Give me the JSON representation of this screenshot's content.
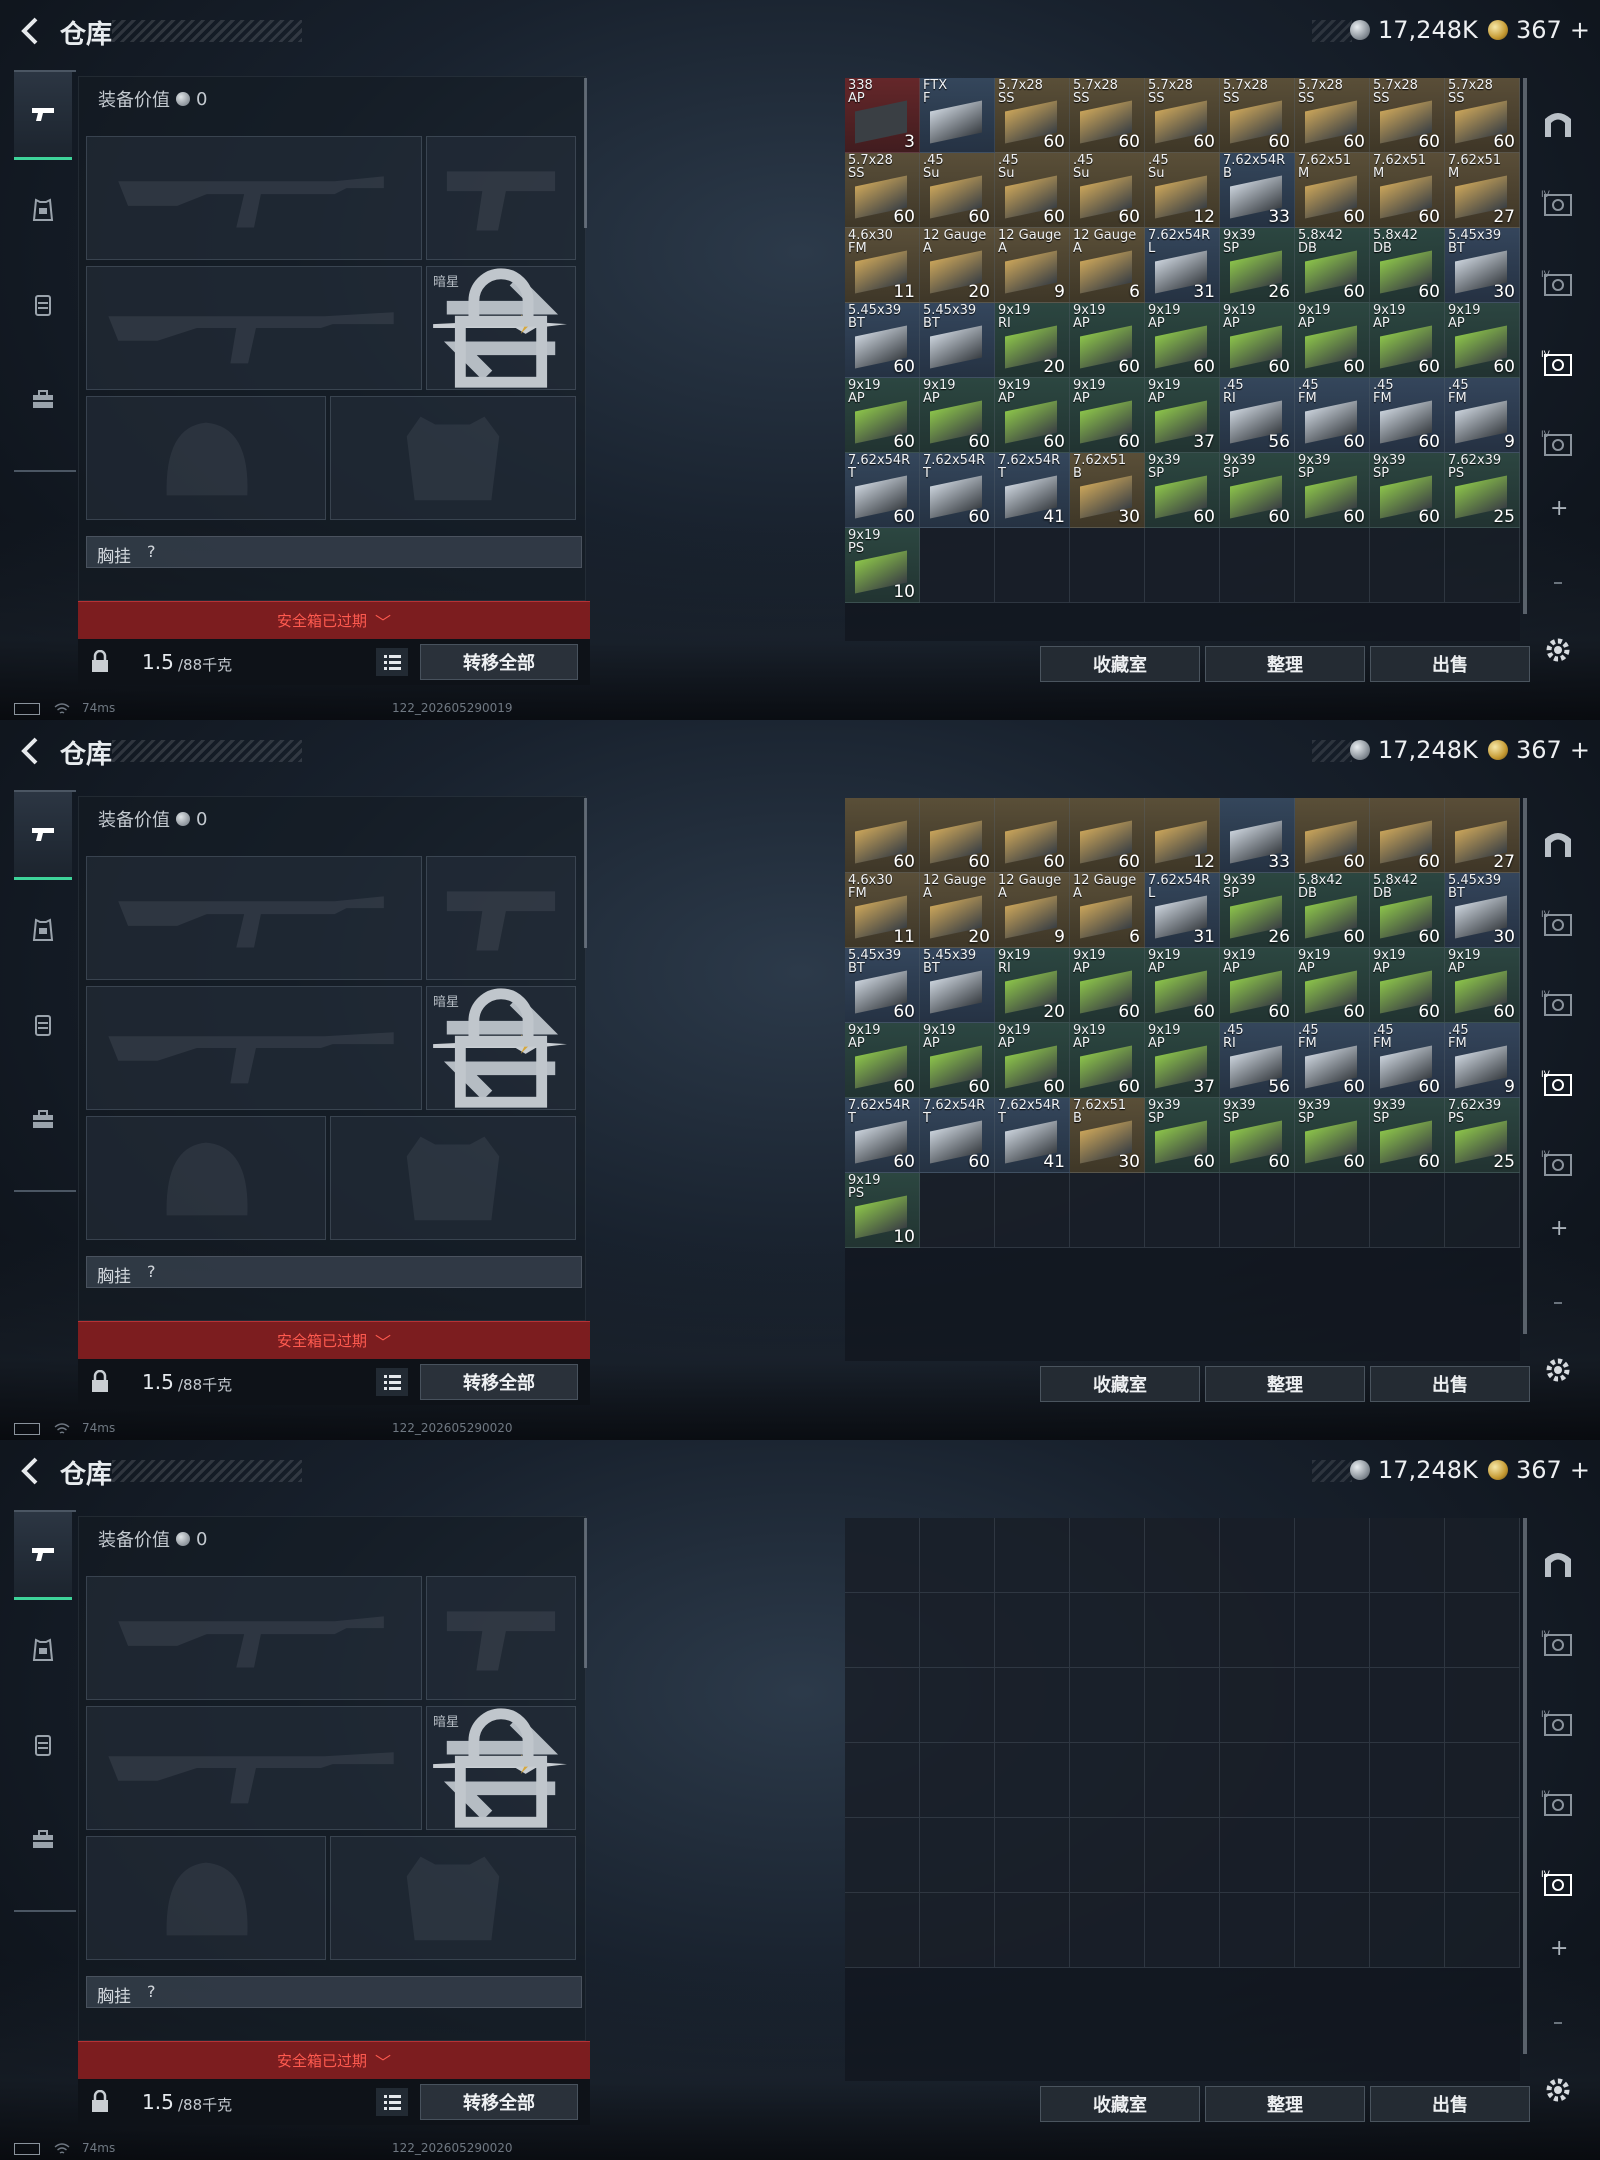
{
  "common": {
    "title": "仓库",
    "silver_amount": "17,248K",
    "gold_amount": "367",
    "gold_plus": "+",
    "equip_value_label": "装备价值",
    "equip_value": "0",
    "knife_label": "暗星",
    "chest_rig_label": "胸挂",
    "chest_rig_help": "?",
    "safe_box_status": "安全箱已过期",
    "safe_box_chevron": "﹀",
    "weight_value": "1.5",
    "weight_unit": "/88千克",
    "transfer_all": "转移全部",
    "collection_room": "收藏室",
    "sort": "整理",
    "sell": "出售",
    "ping": "74ms",
    "accent_color": "#3ed39a",
    "warning_color": "#ff5a4f"
  },
  "screens": [
    {
      "build_id": "122_202605290019",
      "active_stash_tab": 3,
      "rows": [
        [
          [
            "338\nAP",
            "3",
            "red"
          ],
          [
            "FTX\nF",
            "",
            "blue"
          ],
          [
            "5.7x28\nSS",
            "60",
            "gold"
          ],
          [
            "5.7x28\nSS",
            "60",
            "gold"
          ],
          [
            "5.7x28\nSS",
            "60",
            "gold"
          ],
          [
            "5.7x28\nSS",
            "60",
            "gold"
          ],
          [
            "5.7x28\nSS",
            "60",
            "gold"
          ],
          [
            "5.7x28\nSS",
            "60",
            "gold"
          ],
          [
            "5.7x28\nSS",
            "60",
            "gold"
          ]
        ],
        [
          [
            "5.7x28\nSS",
            "60",
            "gold"
          ],
          [
            ".45\nSu",
            "60",
            "gold"
          ],
          [
            ".45\nSu",
            "60",
            "gold"
          ],
          [
            ".45\nSu",
            "60",
            "gold"
          ],
          [
            ".45\nSu",
            "12",
            "gold"
          ],
          [
            "7.62x54R\nB",
            "33",
            "blue"
          ],
          [
            "7.62x51\nM",
            "60",
            "gold"
          ],
          [
            "7.62x51\nM",
            "60",
            "gold"
          ],
          [
            "7.62x51\nM",
            "27",
            "gold"
          ]
        ],
        [
          [
            "4.6x30\nFM",
            "11",
            "gold"
          ],
          [
            "12 Gauge\nA",
            "20",
            "gold"
          ],
          [
            "12 Gauge\nA",
            "9",
            "gold"
          ],
          [
            "12 Gauge\nA",
            "6",
            "gold"
          ],
          [
            "7.62x54R\nL",
            "31",
            "blue"
          ],
          [
            "9x39\nSP",
            "26",
            "green"
          ],
          [
            "5.8x42\nDB",
            "60",
            "green"
          ],
          [
            "5.8x42\nDB",
            "60",
            "green"
          ],
          [
            "5.45x39\nBT",
            "30",
            "blue"
          ]
        ],
        [
          [
            "5.45x39\nBT",
            "60",
            "blue"
          ],
          [
            "5.45x39\nBT",
            "",
            "blue"
          ],
          [
            "9x19\nRI",
            "20",
            "green"
          ],
          [
            "9x19\nAP",
            "60",
            "green"
          ],
          [
            "9x19\nAP",
            "60",
            "green"
          ],
          [
            "9x19\nAP",
            "60",
            "green"
          ],
          [
            "9x19\nAP",
            "60",
            "green"
          ],
          [
            "9x19\nAP",
            "60",
            "green"
          ],
          [
            "9x19\nAP",
            "60",
            "green"
          ]
        ],
        [
          [
            "9x19\nAP",
            "60",
            "green"
          ],
          [
            "9x19\nAP",
            "60",
            "green"
          ],
          [
            "9x19\nAP",
            "60",
            "green"
          ],
          [
            "9x19\nAP",
            "60",
            "green"
          ],
          [
            "9x19\nAP",
            "37",
            "green"
          ],
          [
            ".45\nRI",
            "56",
            "blue"
          ],
          [
            ".45\nFM",
            "60",
            "blue"
          ],
          [
            ".45\nFM",
            "60",
            "blue"
          ],
          [
            ".45\nFM",
            "9",
            "blue"
          ]
        ],
        [
          [
            "7.62x54R\nT",
            "60",
            "blue"
          ],
          [
            "7.62x54R\nT",
            "60",
            "blue"
          ],
          [
            "7.62x54R\nT",
            "41",
            "blue"
          ],
          [
            "7.62x51\nB",
            "30",
            "gold"
          ],
          [
            "9x39\nSP",
            "60",
            "green"
          ],
          [
            "9x39\nSP",
            "60",
            "green"
          ],
          [
            "9x39\nSP",
            "60",
            "green"
          ],
          [
            "9x39\nSP",
            "60",
            "green"
          ],
          [
            "7.62x39\nPS",
            "25",
            "green"
          ]
        ],
        [
          [
            "9x19\nPS",
            "10",
            "green"
          ],
          null,
          null,
          null,
          null,
          null,
          null,
          null,
          null
        ]
      ]
    },
    {
      "build_id": "122_202605290020",
      "active_stash_tab": 3,
      "rows": [
        [
          [
            "",
            "60",
            "gold"
          ],
          [
            "",
            "60",
            "gold"
          ],
          [
            "",
            "60",
            "gold"
          ],
          [
            "",
            "60",
            "gold"
          ],
          [
            "",
            "12",
            "gold"
          ],
          [
            "",
            "33",
            "blue"
          ],
          [
            "",
            "60",
            "gold"
          ],
          [
            "",
            "60",
            "gold"
          ],
          [
            "",
            "27",
            "gold"
          ]
        ],
        [
          [
            "4.6x30\nFM",
            "11",
            "gold"
          ],
          [
            "12 Gauge\nA",
            "20",
            "gold"
          ],
          [
            "12 Gauge\nA",
            "9",
            "gold"
          ],
          [
            "12 Gauge\nA",
            "6",
            "gold"
          ],
          [
            "7.62x54R\nL",
            "31",
            "blue"
          ],
          [
            "9x39\nSP",
            "26",
            "green"
          ],
          [
            "5.8x42\nDB",
            "60",
            "green"
          ],
          [
            "5.8x42\nDB",
            "60",
            "green"
          ],
          [
            "5.45x39\nBT",
            "30",
            "blue"
          ]
        ],
        [
          [
            "5.45x39\nBT",
            "60",
            "blue"
          ],
          [
            "5.45x39\nBT",
            "",
            "blue"
          ],
          [
            "9x19\nRI",
            "20",
            "green"
          ],
          [
            "9x19\nAP",
            "60",
            "green"
          ],
          [
            "9x19\nAP",
            "60",
            "green"
          ],
          [
            "9x19\nAP",
            "60",
            "green"
          ],
          [
            "9x19\nAP",
            "60",
            "green"
          ],
          [
            "9x19\nAP",
            "60",
            "green"
          ],
          [
            "9x19\nAP",
            "60",
            "green"
          ]
        ],
        [
          [
            "9x19\nAP",
            "60",
            "green"
          ],
          [
            "9x19\nAP",
            "60",
            "green"
          ],
          [
            "9x19\nAP",
            "60",
            "green"
          ],
          [
            "9x19\nAP",
            "60",
            "green"
          ],
          [
            "9x19\nAP",
            "37",
            "green"
          ],
          [
            ".45\nRI",
            "56",
            "blue"
          ],
          [
            ".45\nFM",
            "60",
            "blue"
          ],
          [
            ".45\nFM",
            "60",
            "blue"
          ],
          [
            ".45\nFM",
            "9",
            "blue"
          ]
        ],
        [
          [
            "7.62x54R\nT",
            "60",
            "blue"
          ],
          [
            "7.62x54R\nT",
            "60",
            "blue"
          ],
          [
            "7.62x54R\nT",
            "41",
            "blue"
          ],
          [
            "7.62x51\nB",
            "30",
            "gold"
          ],
          [
            "9x39\nSP",
            "60",
            "green"
          ],
          [
            "9x39\nSP",
            "60",
            "green"
          ],
          [
            "9x39\nSP",
            "60",
            "green"
          ],
          [
            "9x39\nSP",
            "60",
            "green"
          ],
          [
            "7.62x39\nPS",
            "25",
            "green"
          ]
        ],
        [
          [
            "9x19\nPS",
            "10",
            "green"
          ],
          null,
          null,
          null,
          null,
          null,
          null,
          null,
          null
        ]
      ]
    },
    {
      "build_id": "122_202605290020",
      "active_stash_tab": 4,
      "rows": [
        [
          null,
          null,
          null,
          null,
          null,
          null,
          null,
          null,
          null
        ],
        [
          null,
          null,
          null,
          null,
          null,
          null,
          null,
          null,
          null
        ],
        [
          null,
          null,
          null,
          null,
          null,
          null,
          null,
          null,
          null
        ],
        [
          null,
          null,
          null,
          null,
          null,
          null,
          null,
          null,
          null
        ],
        [
          null,
          null,
          null,
          null,
          null,
          null,
          null,
          null,
          null
        ],
        [
          null,
          null,
          null,
          null,
          null,
          null,
          null,
          null,
          null
        ]
      ]
    }
  ]
}
